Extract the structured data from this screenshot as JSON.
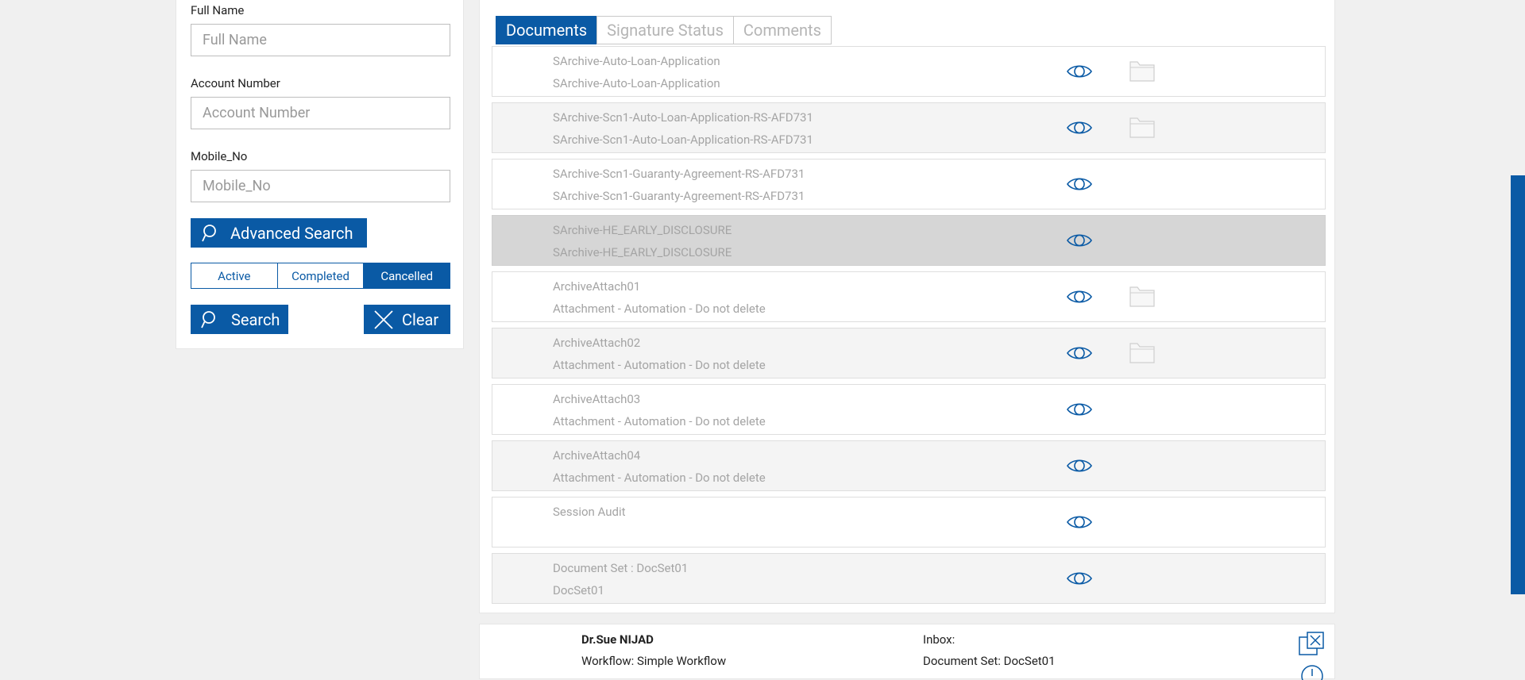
{
  "filters": {
    "full_name": {
      "label": "Full Name",
      "placeholder": "Full Name"
    },
    "account_number": {
      "label": "Account Number",
      "placeholder": "Account Number"
    },
    "mobile_no": {
      "label": "Mobile_No",
      "placeholder": "Mobile_No"
    },
    "advanced_search_label": "Advanced Search",
    "status_options": [
      "Active",
      "Completed",
      "Cancelled"
    ],
    "selected_status": "Cancelled",
    "search_label": "Search",
    "clear_label": "Clear"
  },
  "tabs": [
    {
      "label": "Documents",
      "active": true
    },
    {
      "label": "Signature Status",
      "active": false
    },
    {
      "label": "Comments",
      "active": false
    }
  ],
  "documents": [
    {
      "title": "SArchive-Auto-Loan-Application",
      "subtitle": "SArchive-Auto-Loan-Application",
      "has_folder": true
    },
    {
      "title": "SArchive-Scn1-Auto-Loan-Application-RS-AFD731",
      "subtitle": "SArchive-Scn1-Auto-Loan-Application-RS-AFD731",
      "has_folder": true
    },
    {
      "title": "SArchive-Scn1-Guaranty-Agreement-RS-AFD731",
      "subtitle": "SArchive-Scn1-Guaranty-Agreement-RS-AFD731",
      "has_folder": false
    },
    {
      "title": "SArchive-HE_EARLY_DISCLOSURE",
      "subtitle": "SArchive-HE_EARLY_DISCLOSURE",
      "has_folder": false,
      "selected": true
    },
    {
      "title": "ArchiveAttach01",
      "subtitle": "Attachment - Automation - Do not delete",
      "has_folder": true
    },
    {
      "title": "ArchiveAttach02",
      "subtitle": "Attachment - Automation - Do not delete",
      "has_folder": true
    },
    {
      "title": "ArchiveAttach03",
      "subtitle": "Attachment - Automation - Do not delete",
      "has_folder": false
    },
    {
      "title": "ArchiveAttach04",
      "subtitle": "Attachment - Automation - Do not delete",
      "has_folder": false
    },
    {
      "title": "Session Audit",
      "subtitle": "",
      "has_folder": false
    },
    {
      "title": "Document Set : DocSet01",
      "subtitle": "DocSet01",
      "has_folder": false
    }
  ],
  "bottom_panel": {
    "name": "Dr.Sue NIJAD",
    "workflow": "Workflow: Simple Workflow",
    "inbox": "Inbox:",
    "document_set": "Document Set: DocSet01"
  },
  "colors": {
    "accent": "#0a5aa5",
    "row_alt": "#f4f4f4",
    "row_selected": "#d6d6d6",
    "muted_text": "#a4a4a4"
  }
}
